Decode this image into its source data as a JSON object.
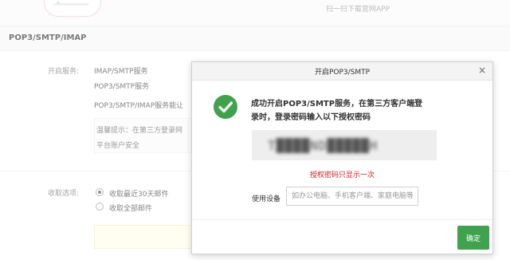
{
  "top": {
    "app_download": "扫一扫下载官网APP"
  },
  "section": {
    "title": "POP3/SMTP/IMAP"
  },
  "services": {
    "label": "开启服务:",
    "items": [
      "IMAP/SMTP服务",
      "POP3/SMTP服务"
    ],
    "note": "POP3/SMTP/IMAP服务能让",
    "tip_line1": "温馨提示：在第三方登录网",
    "tip_line2": "平台账户安全"
  },
  "receive": {
    "label": "收取选项:",
    "options": [
      {
        "label": "收取最近30天邮件",
        "selected": true
      },
      {
        "label": "收取全部邮件",
        "selected": false
      }
    ]
  },
  "dialog": {
    "title": "开启POP3/SMTP",
    "close_glyph": "×",
    "success_line1": "成功开启POP3/SMTP服务，在第三方客户端登",
    "success_line2": "录时，登录密码输入以下授权密码",
    "auth_code": "T████ND█████H",
    "one_time_notice": "授权密码只显示一次",
    "device_label": "使用设备",
    "device_placeholder": "如办公电脑、手机客户端、家庭电脑等",
    "device_value": "",
    "confirm_label": "确定"
  },
  "colors": {
    "success_green": "#3fa34d",
    "notice_red": "#d02020",
    "confirm_button": "#3fa34d"
  },
  "icons": {
    "success": "check-circle-icon",
    "close": "close-icon"
  }
}
